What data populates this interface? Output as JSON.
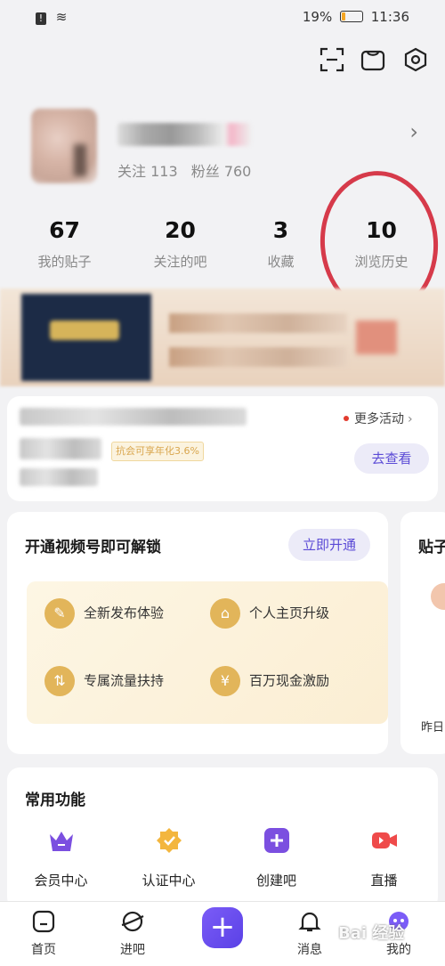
{
  "status": {
    "battery": "19%",
    "time": "11:36",
    "battery_level": 0.19
  },
  "profile": {
    "follow": "关注 113",
    "fans": "粉丝 760"
  },
  "stats": [
    {
      "num": "67",
      "label": "我的贴子"
    },
    {
      "num": "20",
      "label": "关注的吧"
    },
    {
      "num": "3",
      "label": "收藏"
    },
    {
      "num": "10",
      "label": "浏览历史"
    }
  ],
  "activity": {
    "more": "更多活动",
    "go": "去查看",
    "yield_text": "抗会可享年化3.6%"
  },
  "video": {
    "title": "开通视频号即可解锁",
    "open": "立即开通",
    "perks": [
      "全新发布体验",
      "个人主页升级",
      "专属流量扶持",
      "百万现金激励"
    ],
    "peek_title": "贴子",
    "peek_small": "昨日"
  },
  "functions": {
    "title": "常用功能",
    "items": [
      "会员中心",
      "认证中心",
      "创建吧",
      "直播"
    ],
    "colors": [
      "#7b4fe0",
      "#f3b63e",
      "#7b4fe0",
      "#ef4a4a"
    ]
  },
  "nav": [
    "首页",
    "进吧",
    "消息",
    "我的"
  ],
  "watermark": "Bai 经验"
}
